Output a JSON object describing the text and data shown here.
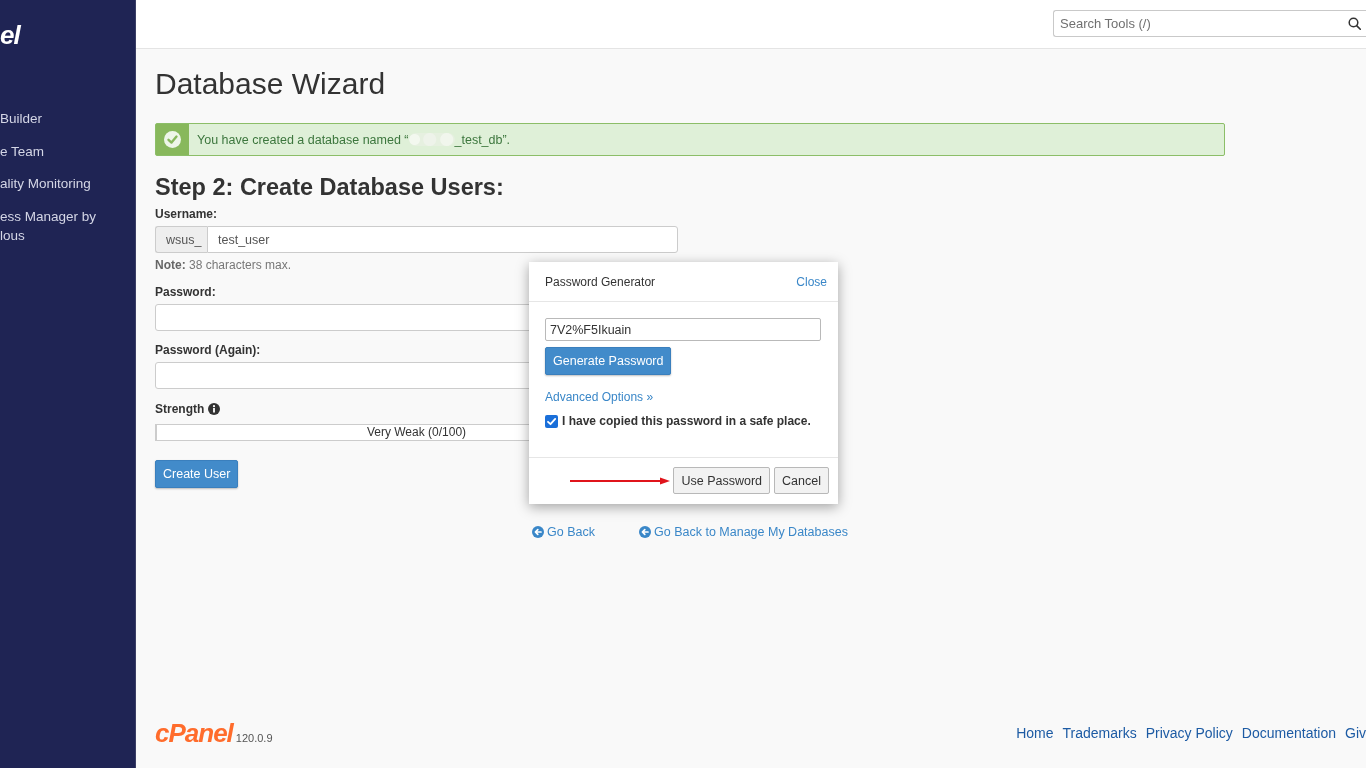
{
  "sidebar": {
    "logo": "el",
    "items": [
      {
        "label": "Builder"
      },
      {
        "label": "e Team"
      },
      {
        "label": "ality Monitoring"
      },
      {
        "label": "ess Manager by lous"
      }
    ]
  },
  "header": {
    "search": {
      "placeholder": "Search Tools (/)"
    }
  },
  "page": {
    "title": "Database Wizard",
    "alert": {
      "kind": "success",
      "text_before": "You have created a database named “",
      "redacted": true,
      "text_after": "_test_db”."
    },
    "step_title": "Step 2: Create Database Users:",
    "form": {
      "username": {
        "label": "Username:",
        "prefix": "wsus_",
        "value": "test_user",
        "note": "**Note:** 38 characters max."
      },
      "password": {
        "label": "Password:"
      },
      "password_again": {
        "label": "Password (Again):"
      },
      "strength": {
        "label": "Strength",
        "level": 0,
        "reading": "Very Weak (0/100)"
      },
      "submit": "Create User"
    },
    "links": [
      {
        "label": "Go Back"
      },
      {
        "label": "Go Back to Manage My Databases"
      }
    ]
  },
  "dialog": {
    "title": "Password Generator",
    "close": "Close",
    "password": "7V2%F5Ikuain",
    "generate": "Generate Password",
    "advanced": "Advanced Options »",
    "confirm": {
      "label": "I have copied this password in a safe place.",
      "checked": true
    },
    "buttons": [
      {
        "label": "Use Password",
        "arrow": true
      },
      {
        "label": "Cancel",
        "arrow": false
      }
    ]
  },
  "footer": {
    "logo": "cPanel",
    "version": "120.0.9",
    "links": [
      {
        "label": "Home"
      },
      {
        "label": "Trademarks"
      },
      {
        "label": "Privacy Policy"
      },
      {
        "label": "Documentation"
      },
      {
        "label": "Giv"
      }
    ]
  }
}
